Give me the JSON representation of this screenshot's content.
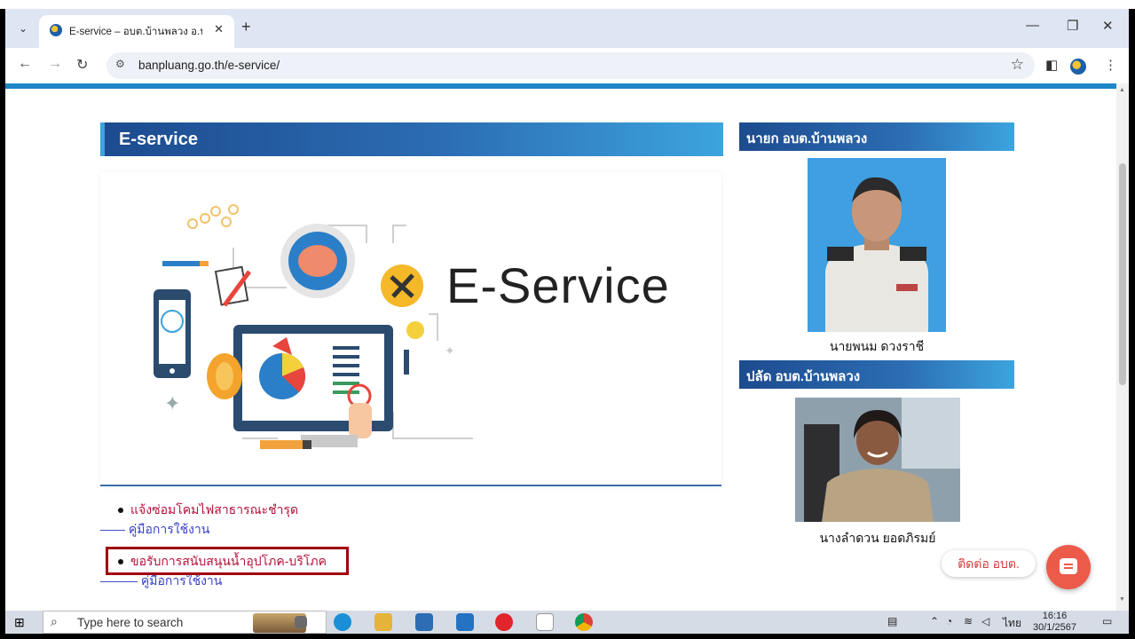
{
  "browser": {
    "tab_title": "E-service – อบต.บ้านพลวง อ.ปราสา",
    "tab_close": "✕",
    "new_tab": "+",
    "url": "banpluang.go.th/e-service/"
  },
  "page": {
    "main_heading": "E-service",
    "banner_text": "E-Service",
    "services": [
      {
        "label": "แจ้งซ่อมโคมไฟสาธารณะชำรุด",
        "sub_prefix": "——",
        "sub_label": "คู่มือการใช้งาน"
      },
      {
        "label": "ขอรับการสนับสนุนน้ำอุปโภค-บริโภค",
        "sub_prefix": "———",
        "sub_label": "คู่มือการใช้งาน"
      }
    ],
    "sidebar": {
      "mayor_heading": "นายก อบต.บ้านพลวง",
      "mayor_name": "นายพนม ดวงราชี",
      "clerk_heading": "ปลัด อบต.บ้านพลวง",
      "clerk_name": "นางลำดวน ยอดภิรมย์"
    },
    "chat_label": "ติดต่อ อบต."
  },
  "taskbar": {
    "search_placeholder": "Type here to search",
    "language": "ไทย",
    "time": "16:16",
    "date": "30/1/2567"
  },
  "colors": {
    "heading_gradient_start": "#1d4b8f",
    "heading_gradient_end": "#3ca4de",
    "service_link": "#b3123b",
    "manual_link": "#3740c9",
    "highlight_border": "#a0000b",
    "chat_button": "#ec5a4a"
  }
}
